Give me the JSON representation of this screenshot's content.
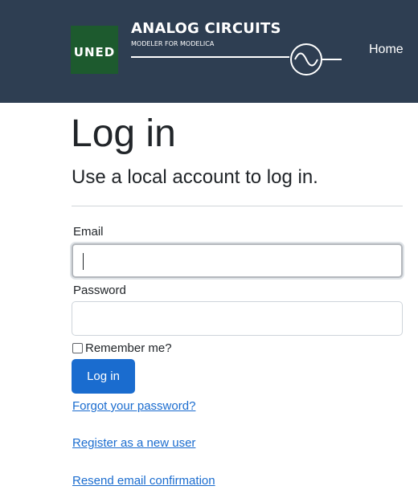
{
  "header": {
    "logo_text": "UNED",
    "brand_title": "ANALOG CIRCUITS",
    "brand_subtitle": "MODELER FOR MODELICA",
    "brand_icon": "sine-wave-icon",
    "nav_home": "Home",
    "colors": {
      "navbar": "#2e3e52",
      "logo": "#1d5a2e"
    }
  },
  "page": {
    "title": "Log in",
    "subtitle": "Use a local account to log in."
  },
  "form": {
    "email_label": "Email",
    "email_value": "",
    "password_label": "Password",
    "password_value": "",
    "remember_label": "Remember me?",
    "remember_checked": false,
    "submit_label": "Log in",
    "accent_color": "#1a6ccf"
  },
  "links": {
    "forgot": "Forgot your password?",
    "register": "Register as a new user",
    "resend": "Resend email confirmation"
  }
}
